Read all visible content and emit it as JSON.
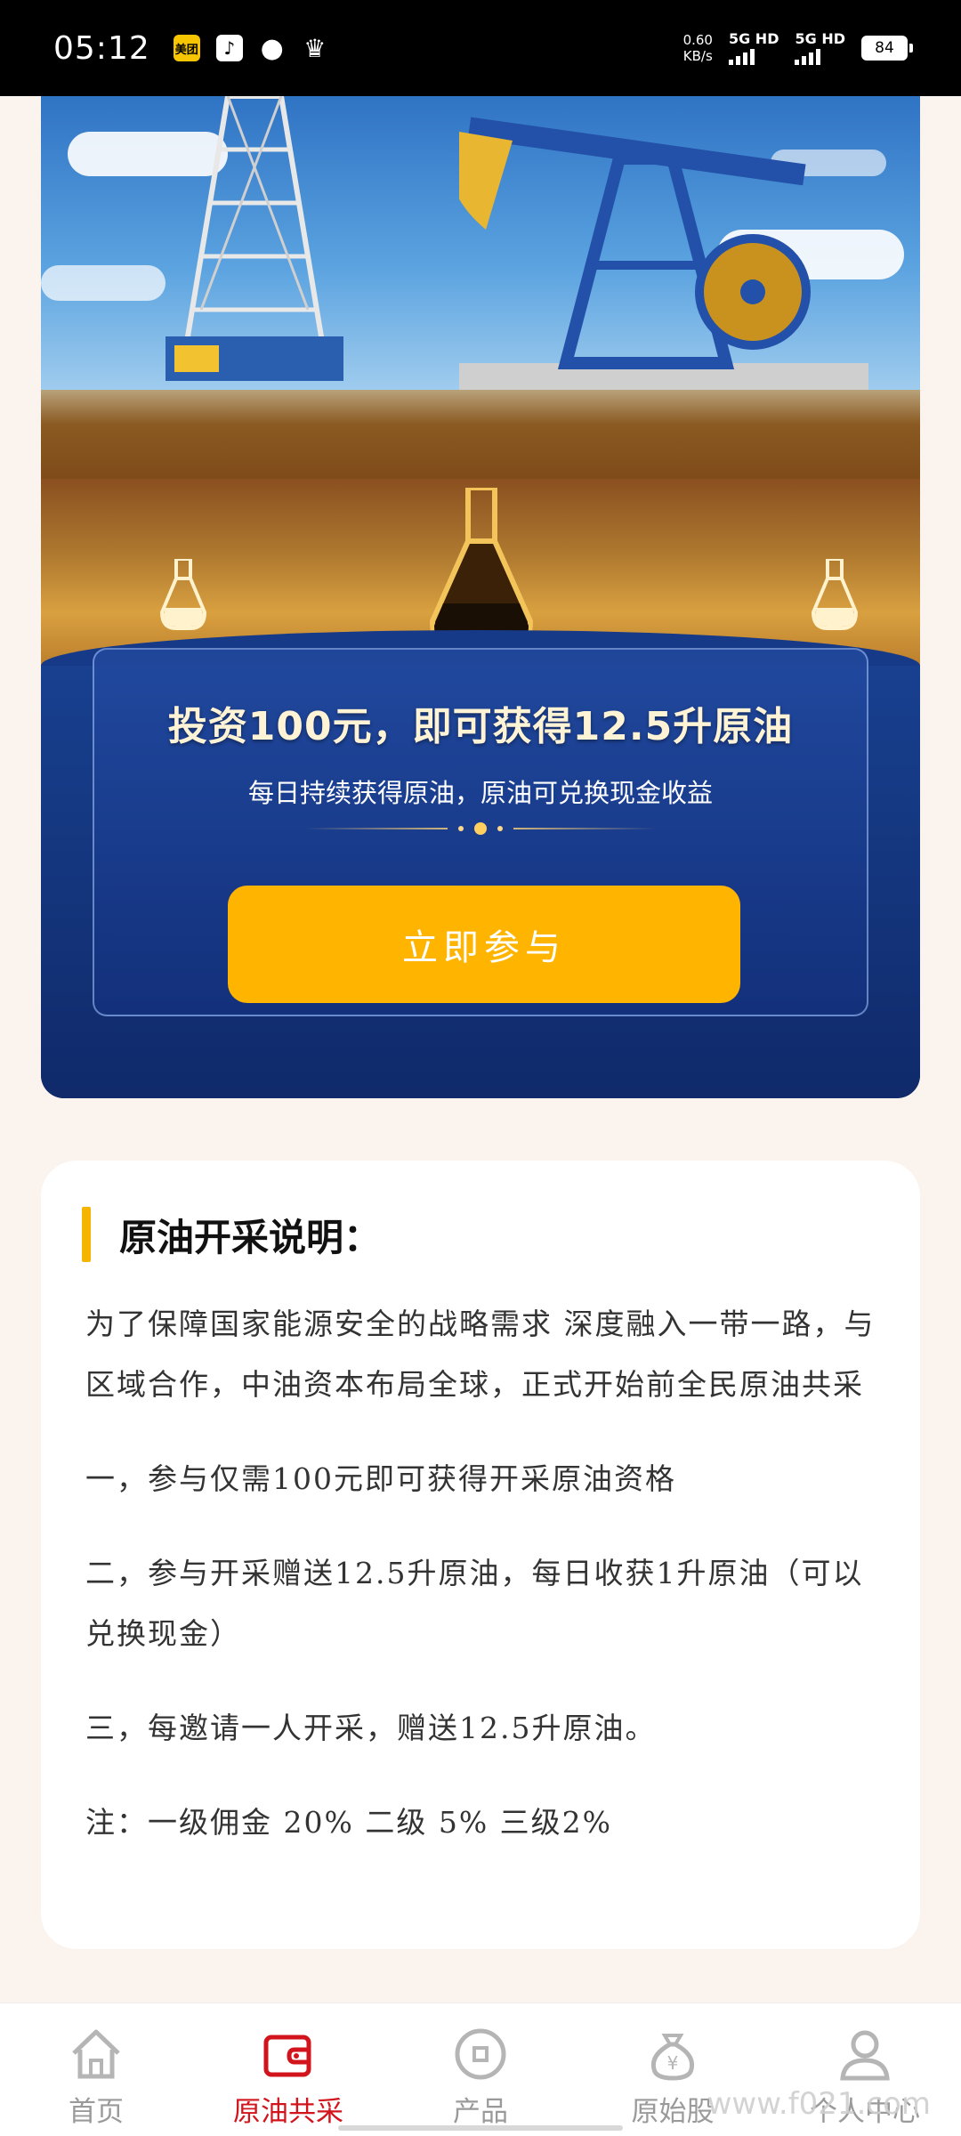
{
  "status_bar": {
    "time": "05:12",
    "app_icons": [
      "meituan-icon",
      "tiktok-icon",
      "chat-bubble-icon",
      "crown-icon"
    ],
    "net_speed": "0.60",
    "net_speed_unit": "KB/s",
    "network_1": "5G HD",
    "network_2": "5G HD",
    "battery": "84"
  },
  "banner": {
    "headline": "投资100元，即可获得12.5升原油",
    "subline": "每日持续获得原油，原油可兑换现金收益",
    "button_label": "立即参与",
    "accent_color": "#ffb400"
  },
  "description": {
    "title": "原油开采说明：",
    "paragraphs": [
      "为了保障国家能源安全的战略需求 深度融入一带一路，与区域合作，中油资本布局全球，正式开始前全民原油共采",
      "一，参与仅需100元即可获得开采原油资格",
      "二，参与开采赠送12.5升原油，每日收获1升原油（可以兑换现金）",
      "三，每邀请一人开采，赠送12.5升原油。",
      "注：一级佣金 20% 二级 5% 三级2%"
    ]
  },
  "bottom_nav": {
    "items": [
      {
        "label": "首页",
        "icon": "home-icon"
      },
      {
        "label": "原油共采",
        "icon": "wallet-icon"
      },
      {
        "label": "产品",
        "icon": "coin-icon"
      },
      {
        "label": "原始股",
        "icon": "money-bag-icon"
      },
      {
        "label": "个人中心",
        "icon": "user-icon"
      }
    ],
    "active_index": 1,
    "active_color": "#d2141c"
  },
  "watermark": "www.f021.com"
}
